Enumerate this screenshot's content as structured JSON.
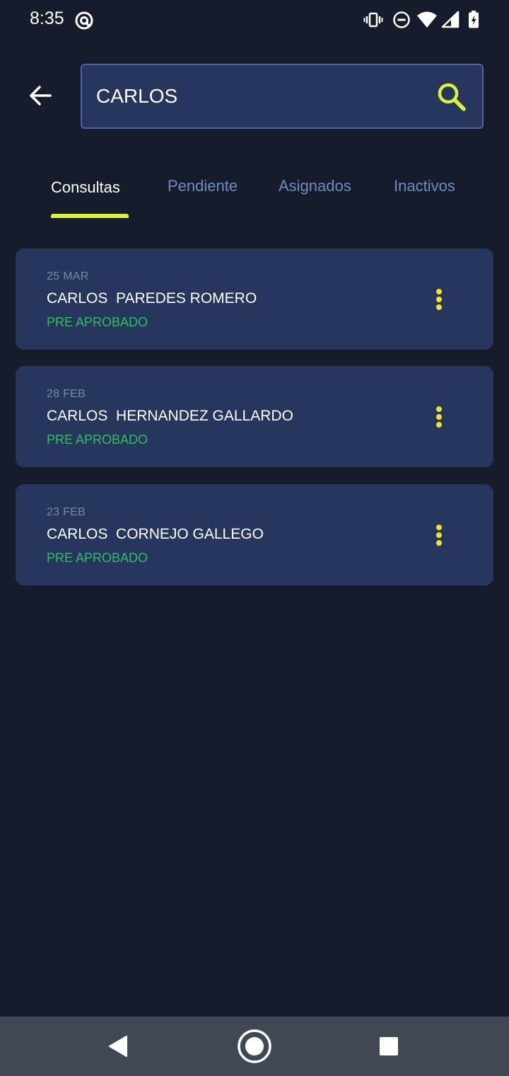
{
  "status_bar": {
    "time": "8:35",
    "icons": [
      "at-icon",
      "vibrate-icon",
      "do-not-disturb-icon",
      "wifi-icon",
      "signal-icon",
      "battery-charging-icon"
    ]
  },
  "header": {
    "back_icon": "arrow-left-icon",
    "search": {
      "value": "CARLOS",
      "icon": "search-icon"
    }
  },
  "tabs": [
    {
      "label": "Consultas",
      "active": true
    },
    {
      "label": "Pendiente",
      "active": false
    },
    {
      "label": "Asignados",
      "active": false
    },
    {
      "label": "Inactivos",
      "active": false
    }
  ],
  "results": [
    {
      "date": "25 MAR",
      "name": "CARLOS  PAREDES ROMERO",
      "status": "PRE APROBADO"
    },
    {
      "date": "28 FEB",
      "name": "CARLOS  HERNANDEZ GALLARDO",
      "status": "PRE APROBADO"
    },
    {
      "date": "23 FEB",
      "name": "CARLOS  CORNEJO GALLEGO",
      "status": "PRE APROBADO"
    }
  ],
  "colors": {
    "background": "#171c2c",
    "card": "#26365c",
    "accent": "#d9f23a",
    "status_green": "#2ebf5f",
    "menu_dots": "#f2e32b",
    "tab_inactive": "#6f8cc2"
  },
  "nav_bar": {
    "icons": [
      "back-triangle-icon",
      "home-circle-icon",
      "recents-square-icon"
    ]
  }
}
